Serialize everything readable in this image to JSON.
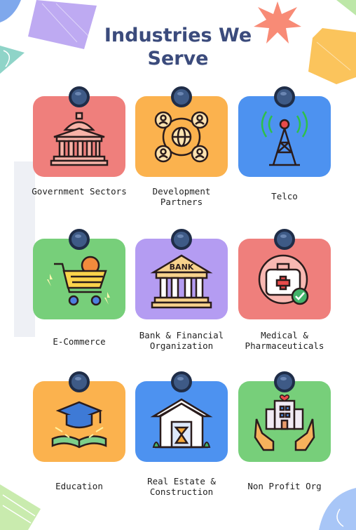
{
  "title_line1": "Industries We",
  "title_line2": "Serve",
  "colors": {
    "title": "#3b4b7c",
    "red": "#ef7f7c",
    "orange": "#fbb24e",
    "blue": "#4d92f0",
    "green": "#77cf7a",
    "purple": "#b49cf2"
  },
  "industries": [
    {
      "label": "Government Sectors",
      "icon": "government-building-icon",
      "color": "red"
    },
    {
      "label": "Development Partners",
      "icon": "network-people-globe-icon",
      "color": "orange"
    },
    {
      "label": "Telco",
      "icon": "cell-tower-icon",
      "color": "blue"
    },
    {
      "label": "E-Commerce",
      "icon": "shopping-cart-icon",
      "color": "green"
    },
    {
      "label": "Bank & Financial Organization",
      "icon": "bank-icon",
      "color": "purple"
    },
    {
      "label": "Medical & Pharmaceuticals",
      "icon": "medical-kit-icon",
      "color": "red"
    },
    {
      "label": "Education",
      "icon": "graduation-cap-book-icon",
      "color": "orange"
    },
    {
      "label": "Real Estate & Construction",
      "icon": "house-construction-icon",
      "color": "blue"
    },
    {
      "label": "Non Profit Org",
      "icon": "hands-holding-building-icon",
      "color": "green"
    }
  ]
}
